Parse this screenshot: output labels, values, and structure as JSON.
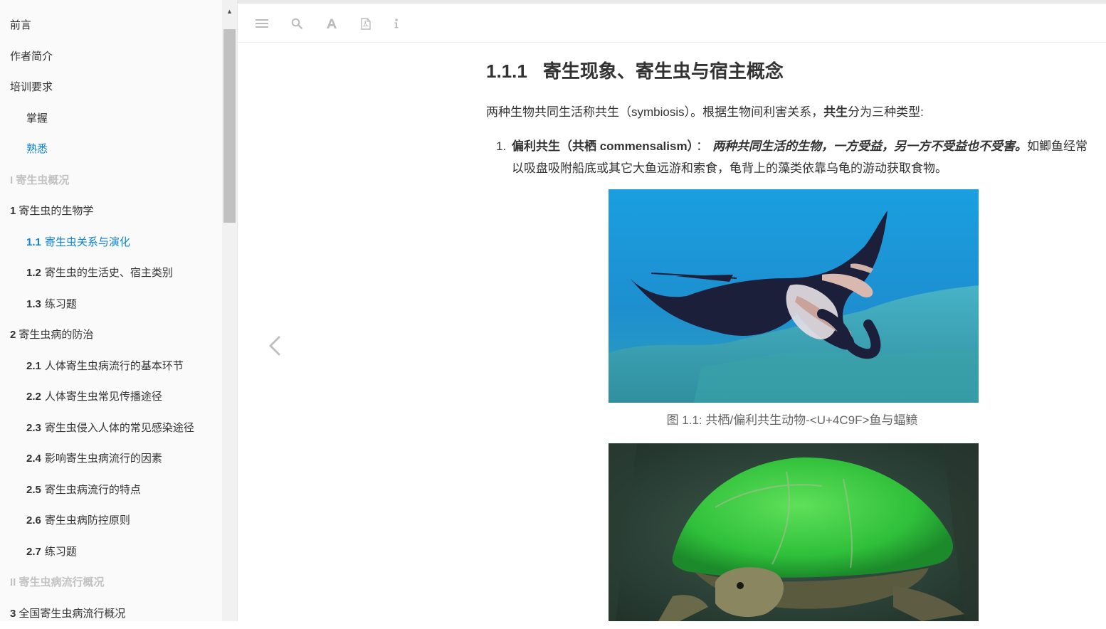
{
  "sidebar": {
    "items": [
      {
        "num": "",
        "label": "前言",
        "kind": "lvl1",
        "active": false
      },
      {
        "num": "",
        "label": "作者简介",
        "kind": "lvl1",
        "active": false
      },
      {
        "num": "",
        "label": "培训要求",
        "kind": "lvl1",
        "active": false
      },
      {
        "num": "",
        "label": "掌握",
        "kind": "lvl2",
        "active": false
      },
      {
        "num": "",
        "label": "熟悉",
        "kind": "lvl2",
        "active": true
      },
      {
        "num": "",
        "label": "I 寄生虫概况",
        "kind": "part",
        "active": false
      },
      {
        "num": "1",
        "label": "寄生虫的生物学",
        "kind": "lvl1",
        "active": false
      },
      {
        "num": "1.1",
        "label": "寄生虫关系与演化",
        "kind": "lvl2",
        "active": true
      },
      {
        "num": "1.2",
        "label": "寄生虫的生活史、宿主类别",
        "kind": "lvl2",
        "active": false
      },
      {
        "num": "1.3",
        "label": "练习题",
        "kind": "lvl2",
        "active": false
      },
      {
        "num": "2",
        "label": "寄生虫病的防治",
        "kind": "lvl1",
        "active": false
      },
      {
        "num": "2.1",
        "label": "人体寄生虫病流行的基本环节",
        "kind": "lvl2",
        "active": false
      },
      {
        "num": "2.2",
        "label": "人体寄生虫常见传播途径",
        "kind": "lvl2",
        "active": false
      },
      {
        "num": "2.3",
        "label": "寄生虫侵入人体的常见感染途径",
        "kind": "lvl2",
        "active": false
      },
      {
        "num": "2.4",
        "label": "影响寄生虫病流行的因素",
        "kind": "lvl2",
        "active": false
      },
      {
        "num": "2.5",
        "label": "寄生虫病流行的特点",
        "kind": "lvl2",
        "active": false
      },
      {
        "num": "2.6",
        "label": "寄生虫病防控原则",
        "kind": "lvl2",
        "active": false
      },
      {
        "num": "2.7",
        "label": "练习题",
        "kind": "lvl2",
        "active": false
      },
      {
        "num": "",
        "label": "II 寄生虫病流行概况",
        "kind": "part",
        "active": false
      },
      {
        "num": "3",
        "label": "全国寄生虫病流行概况",
        "kind": "lvl1",
        "active": false
      }
    ]
  },
  "toolbar": {
    "buttons": [
      "menu-icon",
      "search-icon",
      "font-icon",
      "pdf-icon",
      "info-icon"
    ]
  },
  "content": {
    "title_num": "1.1.1",
    "title_text": "寄生现象、寄生虫与宿主概念",
    "para1_before": "两种生物共同生活称共生（symbiosis）。根据生物间利害关系，",
    "para1_bold": "共生",
    "para1_after": "分为三种类型:",
    "list": [
      {
        "marker": "1.",
        "term": "偏利共生（共栖 commensalism）",
        "sep": "：",
        "def": "两种共同生活的生物，一方受益，另一方不受益也不受害。",
        "rest": "如鲫鱼经常以吸盘吸附船底或其它大鱼远游和索食，龟背上的藻类依靠乌龟的游动获取食物。"
      }
    ],
    "figure1_caption": "图 1.1: 共栖/偏利共生动物-<U+4C9F>鱼与蝠鲼"
  },
  "colors": {
    "accent": "#0c82d8",
    "part_heading": "#c2c2c2",
    "sidebar_bg": "#fafafa",
    "caption": "#666666"
  }
}
